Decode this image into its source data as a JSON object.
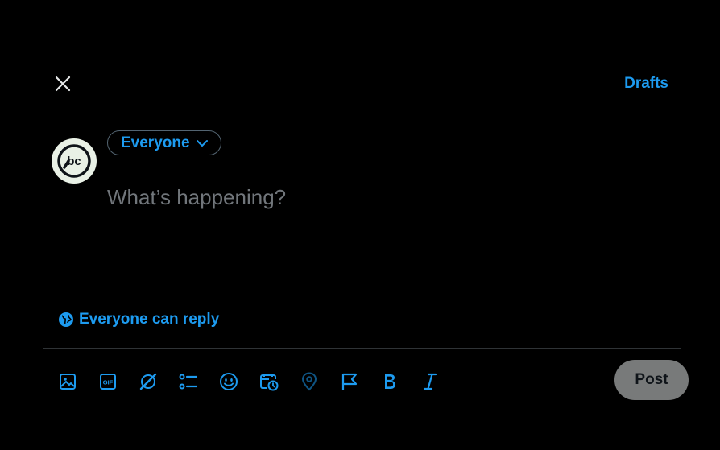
{
  "header": {
    "close_icon": "close-icon",
    "drafts_label": "Drafts"
  },
  "composer": {
    "audience_label": "Everyone",
    "placeholder": "What’s happening?",
    "reply_setting_label": "Everyone can reply",
    "avatar_text": "bc"
  },
  "toolbar": {
    "icons": [
      "media-icon",
      "gif-icon",
      "grok-icon",
      "poll-icon",
      "emoji-icon",
      "schedule-icon",
      "location-icon",
      "flag-icon",
      "bold-icon",
      "italic-icon"
    ],
    "post_label": "Post"
  },
  "colors": {
    "accent": "#1d9bf0",
    "background": "#000000",
    "placeholder": "#71767b",
    "post_button_disabled": "#787a7a"
  }
}
